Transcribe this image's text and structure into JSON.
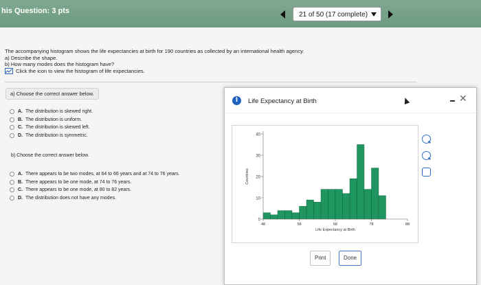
{
  "header": {
    "question_label": "his Question: 3 pts",
    "progress": "21 of 50 (17 complete)"
  },
  "prompt": {
    "line1": "The accompanying histogram shows the life expectancies at birth for 190 countries as collected by an international health agency.",
    "line2": "a) Describe the shape.",
    "line3": "b) How many modes does the histogram have?",
    "line4": "Click the icon to view the histogram of life expectancies."
  },
  "part_a": {
    "label": "a) Choose the correct answer below.",
    "options": [
      {
        "letter": "A.",
        "text": "The distribution is skewed right."
      },
      {
        "letter": "B.",
        "text": "The distribution is uniform."
      },
      {
        "letter": "C.",
        "text": "The distribution is skewed left."
      },
      {
        "letter": "D.",
        "text": "The distribution is symmetric."
      }
    ]
  },
  "part_b": {
    "label": "b) Choose the correct answer below.",
    "options": [
      {
        "letter": "A.",
        "text": "There appears to be two modes, at 64 to 66 years and at 74 to 76 years."
      },
      {
        "letter": "B.",
        "text": "There appears to be one mode, at 74 to 76 years."
      },
      {
        "letter": "C.",
        "text": "There appears to be one mode, at 80 to 82 years."
      },
      {
        "letter": "D.",
        "text": "The distribution does not have any modes."
      }
    ]
  },
  "modal": {
    "title": "Life Expectancy at Birth",
    "print_label": "Print",
    "done_label": "Done"
  },
  "colors": {
    "bar": "#1f9560",
    "header": "#6f9d83",
    "accent": "#1f5fbf"
  },
  "chart_data": {
    "type": "bar",
    "title": "",
    "xlabel": "Life Expectancy at Birth",
    "ylabel": "Countries",
    "x_ticks": [
      48,
      58,
      68,
      78,
      88
    ],
    "y_ticks": [
      0,
      10,
      20,
      30,
      40
    ],
    "ylim": [
      0,
      40
    ],
    "xlim": [
      48,
      88
    ],
    "bin_width": 2,
    "bins": [
      {
        "start": 48,
        "value": 3
      },
      {
        "start": 50,
        "value": 2
      },
      {
        "start": 52,
        "value": 4
      },
      {
        "start": 54,
        "value": 4
      },
      {
        "start": 56,
        "value": 3
      },
      {
        "start": 58,
        "value": 6
      },
      {
        "start": 60,
        "value": 9
      },
      {
        "start": 62,
        "value": 8
      },
      {
        "start": 64,
        "value": 14
      },
      {
        "start": 66,
        "value": 14
      },
      {
        "start": 68,
        "value": 14
      },
      {
        "start": 70,
        "value": 12
      },
      {
        "start": 72,
        "value": 19
      },
      {
        "start": 74,
        "value": 35
      },
      {
        "start": 76,
        "value": 14
      },
      {
        "start": 78,
        "value": 24
      },
      {
        "start": 80,
        "value": 11
      },
      {
        "start": 82,
        "value": 0
      },
      {
        "start": 84,
        "value": 0
      },
      {
        "start": 86,
        "value": 0
      }
    ]
  }
}
